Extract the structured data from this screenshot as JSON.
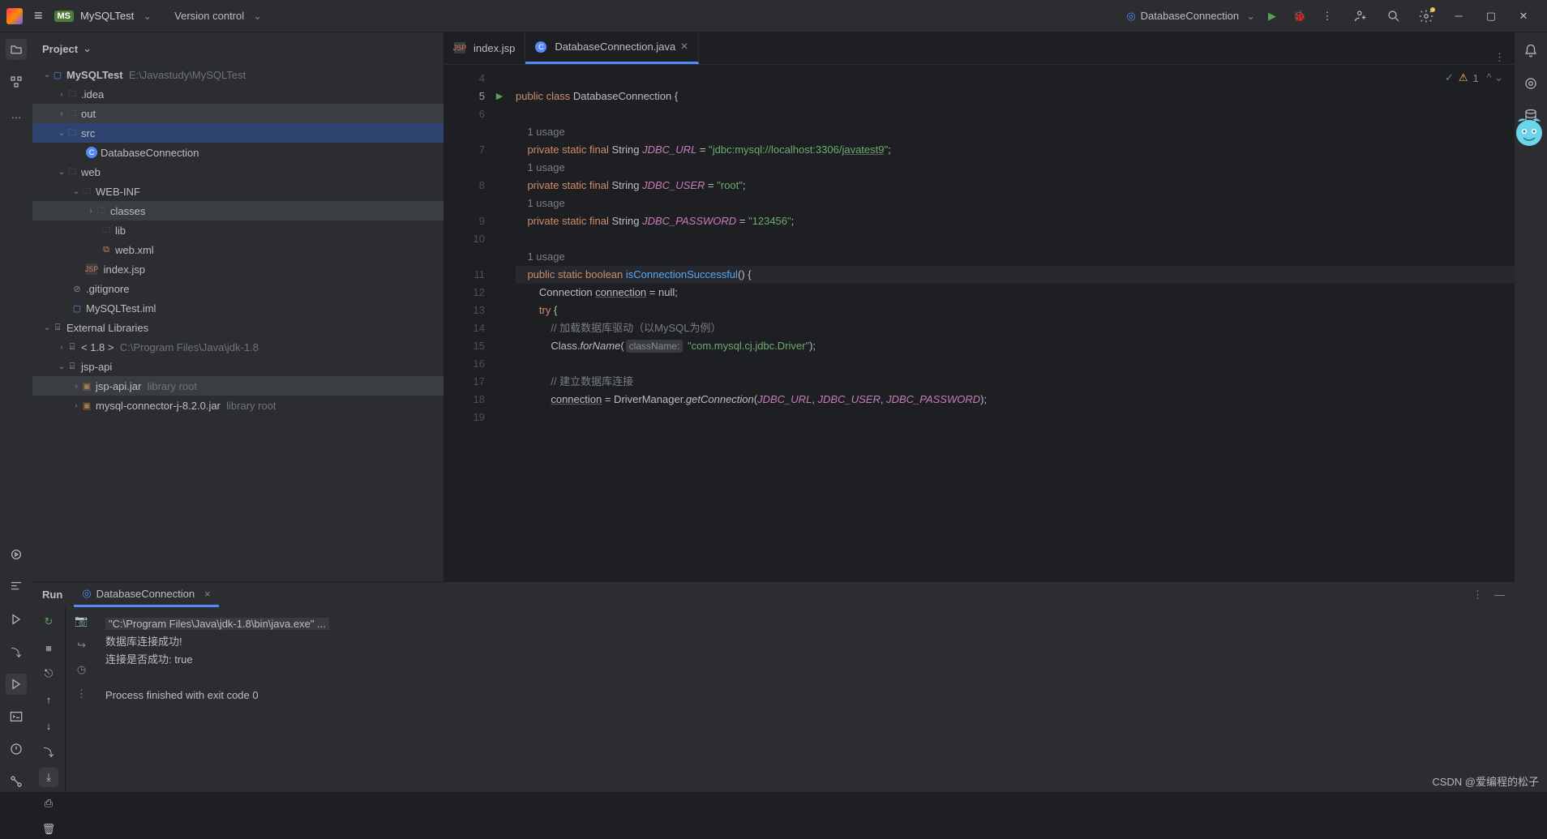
{
  "titlebar": {
    "project_badge": "MS",
    "project_name": "MySQLTest",
    "version_control": "Version control",
    "run_config": "DatabaseConnection"
  },
  "project_panel": {
    "title": "Project"
  },
  "tree": {
    "root": "MySQLTest",
    "root_path": "E:\\Javastudy\\MySQLTest",
    "idea": ".idea",
    "out": "out",
    "src": "src",
    "db_conn": "DatabaseConnection",
    "web": "web",
    "webinf": "WEB-INF",
    "classes": "classes",
    "lib": "lib",
    "webxml": "web.xml",
    "indexjsp": "index.jsp",
    "gitignore": ".gitignore",
    "iml": "MySQLTest.iml",
    "ext_lib": "External Libraries",
    "jdk": "< 1.8 >",
    "jdk_path": "C:\\Program Files\\Java\\jdk-1.8",
    "jspapi": "jsp-api",
    "jspapijar": "jsp-api.jar",
    "library_root": "library root",
    "mysqljar": "mysql-connector-j-8.2.0.jar"
  },
  "tabs": {
    "tab1": "index.jsp",
    "tab2": "DatabaseConnection.java"
  },
  "analysis": {
    "count": "1"
  },
  "code": {
    "usage": "1 usage",
    "l5_a": "public",
    "l5_b": "class",
    "l5_c": "DatabaseConnection",
    "l5_d": "{",
    "l7_kw": "private static final",
    "l7_t": "String",
    "l7_n": "JDBC_URL",
    "l7_eq": "= ",
    "l7_s1": "\"jdbc:mysql://localhost:3306/",
    "l7_s2": "javatest9",
    "l7_s3": "\"",
    "l7_end": ";",
    "l8_n": "JDBC_USER",
    "l8_s": "\"root\"",
    "l9_n": "JDBC_PASSWORD",
    "l9_s": "\"123456\"",
    "l11_a": "public static",
    "l11_b": "boolean",
    "l11_c": "isConnectionSuccessful",
    "l11_d": "() {",
    "l12": "        Connection ",
    "l12_u": "connection",
    "l12_b": " = null;",
    "l13": "        try {",
    "l14": "            ",
    "l14_c": "// 加载数据库驱动（以MySQL为例）",
    "l15_a": "            Class.",
    "l15_b": "forName",
    "l15_c": "(",
    "l15_in": "className:",
    "l15_s": " \"com.mysql.cj.jdbc.Driver\"",
    "l15_e": ");",
    "l17": "            ",
    "l17_c": "// 建立数据库连接",
    "l18_a": "            ",
    "l18_u": "connection",
    "l18_b": " = DriverManager.",
    "l18_f": "getConnection",
    "l18_c": "(",
    "l18_p1": "JDBC_URL",
    "l18_s1": ", ",
    "l18_p2": "JDBC_USER",
    "l18_s2": ", ",
    "l18_p3": "JDBC_PASSWORD",
    "l18_e": ");"
  },
  "run": {
    "label": "Run",
    "tab": "DatabaseConnection",
    "cmd": "\"C:\\Program Files\\Java\\jdk-1.8\\bin\\java.exe\" ...",
    "l2": "数据库连接成功!",
    "l3": "连接是否成功: true",
    "l4": "Process finished with exit code 0"
  },
  "watermark": "CSDN @爱编程的松子"
}
